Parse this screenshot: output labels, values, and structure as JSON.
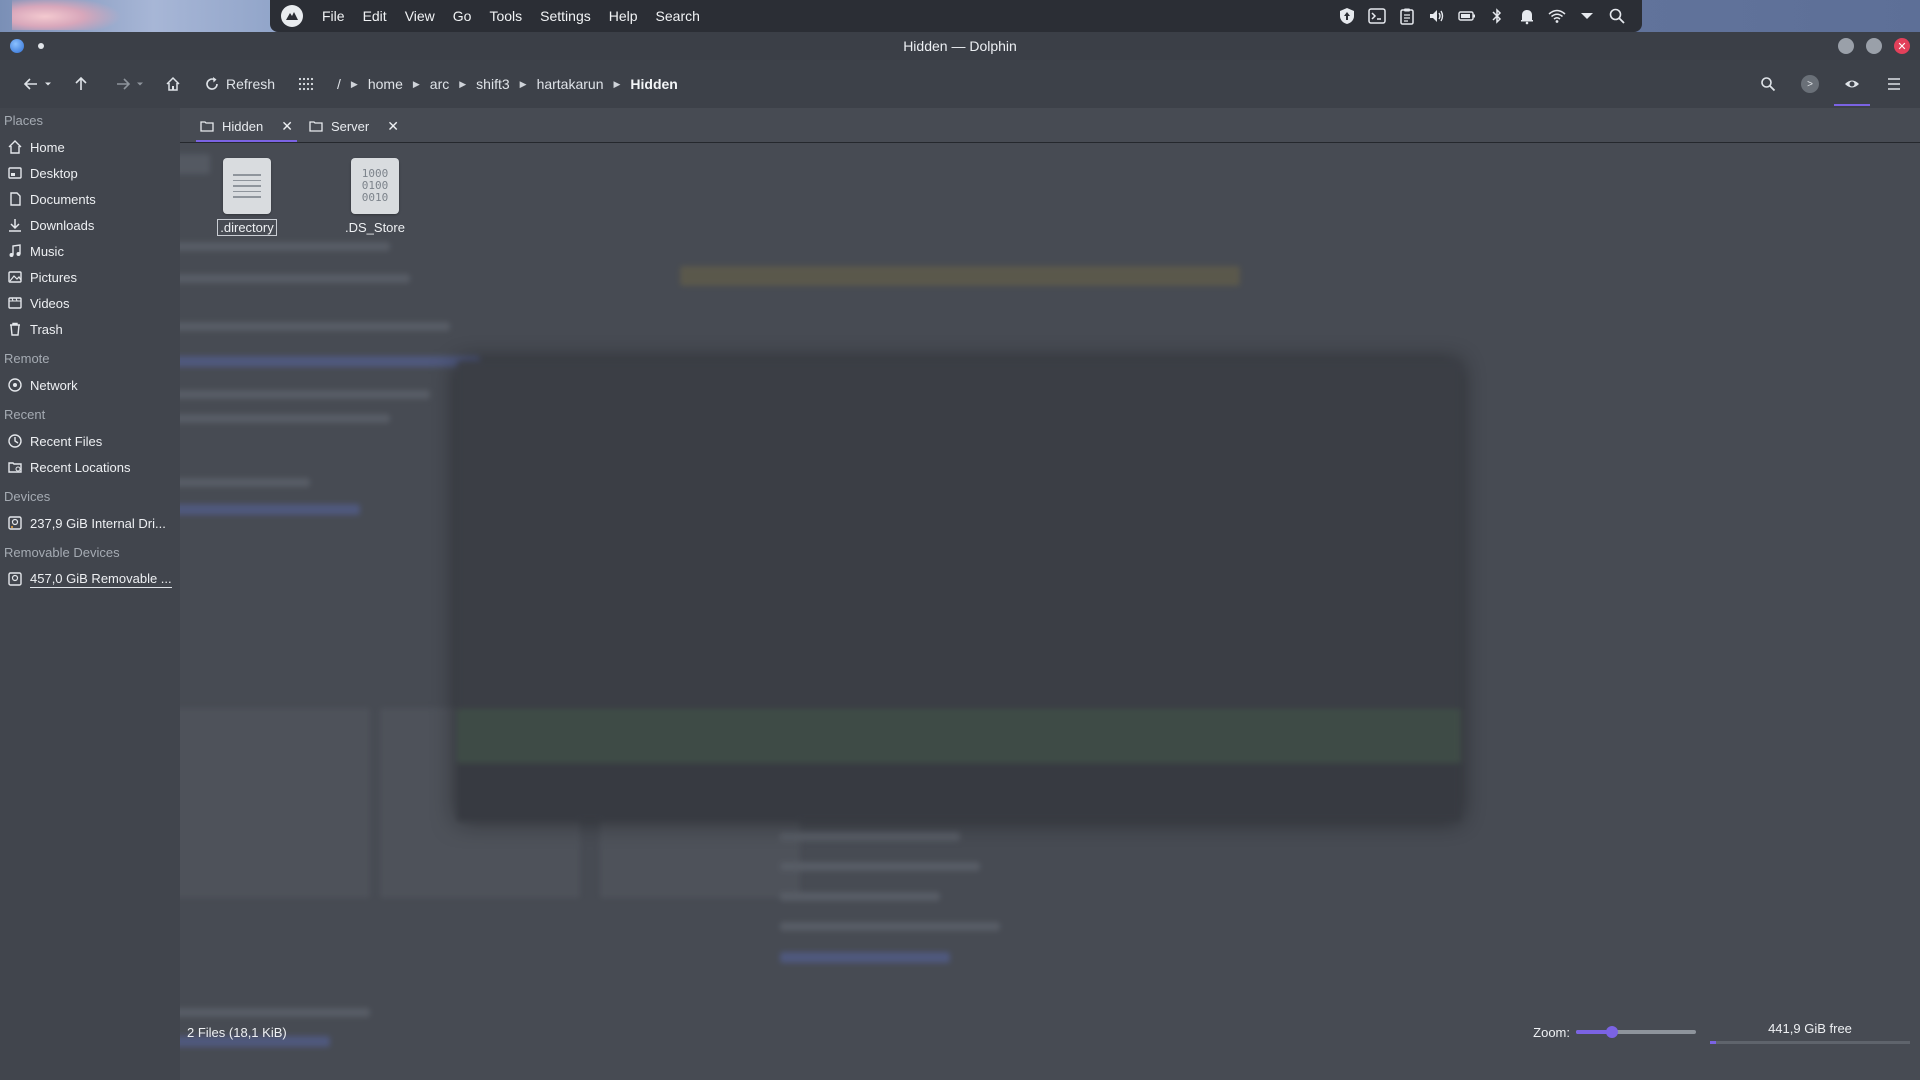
{
  "panel": {
    "menus": [
      "File",
      "Edit",
      "View",
      "Go",
      "Tools",
      "Settings",
      "Help",
      "Search"
    ],
    "tray_icons": [
      "shield-update-icon",
      "terminal-icon",
      "clipboard-icon",
      "volume-icon",
      "battery-icon",
      "bluetooth-icon",
      "notifications-icon",
      "wifi-icon",
      "tray-expand-icon",
      "search-icon"
    ]
  },
  "window": {
    "title": "Hidden — Dolphin"
  },
  "toolbar": {
    "refresh_label": "Refresh",
    "breadcrumb": [
      "/",
      "home",
      "arc",
      "shift3",
      "hartakarun",
      "Hidden"
    ]
  },
  "sidebar": {
    "sections": [
      {
        "heading": "Places",
        "items": [
          {
            "label": "Home",
            "icon": "home-icon"
          },
          {
            "label": "Desktop",
            "icon": "desktop-icon"
          },
          {
            "label": "Documents",
            "icon": "documents-icon"
          },
          {
            "label": "Downloads",
            "icon": "downloads-icon"
          },
          {
            "label": "Music",
            "icon": "music-icon"
          },
          {
            "label": "Pictures",
            "icon": "pictures-icon"
          },
          {
            "label": "Videos",
            "icon": "videos-icon"
          },
          {
            "label": "Trash",
            "icon": "trash-icon"
          }
        ]
      },
      {
        "heading": "Remote",
        "items": [
          {
            "label": "Network",
            "icon": "network-icon"
          }
        ]
      },
      {
        "heading": "Recent",
        "items": [
          {
            "label": "Recent Files",
            "icon": "clock-icon"
          },
          {
            "label": "Recent Locations",
            "icon": "folder-clock-icon"
          }
        ]
      },
      {
        "heading": "Devices",
        "items": [
          {
            "label": "237,9 GiB Internal Dri...",
            "icon": "drive-icon"
          }
        ]
      },
      {
        "heading": "Removable Devices",
        "items": [
          {
            "label": "457,0 GiB Removable ...",
            "icon": "removable-drive-icon"
          }
        ]
      }
    ]
  },
  "tabs": [
    {
      "label": "Hidden",
      "active": true
    },
    {
      "label": "Server",
      "active": false
    }
  ],
  "files": [
    {
      "name": ".directory",
      "type": "text",
      "selected": true
    },
    {
      "name": ".DS_Store",
      "type": "binary",
      "selected": false,
      "binary_text": [
        "1000",
        "0100",
        "0010"
      ]
    }
  ],
  "status": {
    "text": "2 Files (18,1 KiB)",
    "zoom_label": "Zoom:",
    "zoom_fraction": 0.3,
    "free_space": "441,9 GiB free",
    "used_fraction": 0.03
  },
  "colors": {
    "accent": "#7b63e3",
    "close": "#e2405a"
  }
}
